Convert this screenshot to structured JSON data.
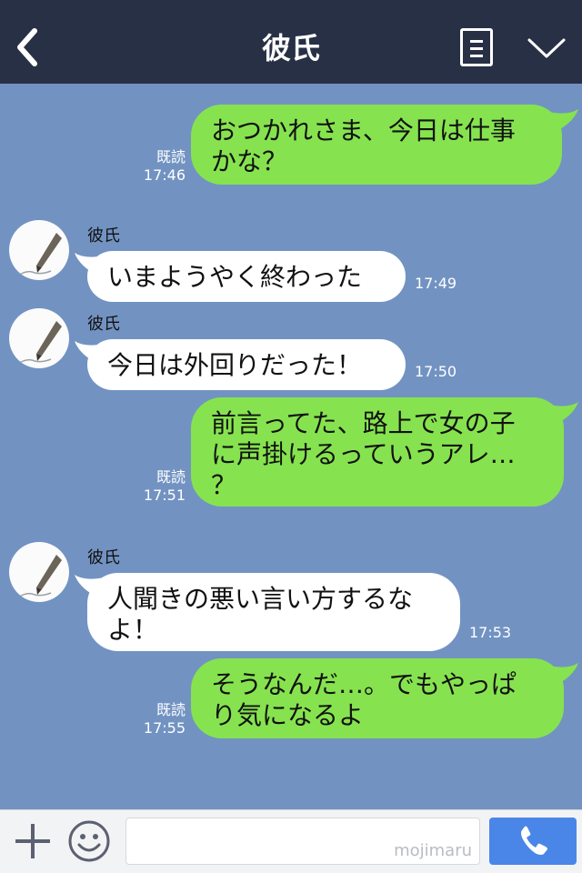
{
  "header": {
    "title": "彼氏"
  },
  "messages": [
    {
      "side": "out",
      "lines": [
        "おつかれさま、今日は仕事",
        "かな？"
      ],
      "read": "既読",
      "time": "17:46"
    },
    {
      "side": "in",
      "sender": "彼氏",
      "lines": [
        "いまようやく終わった"
      ],
      "time": "17:49"
    },
    {
      "side": "in",
      "sender": "彼氏",
      "lines": [
        "今日は外回りだった！"
      ],
      "time": "17:50"
    },
    {
      "side": "out",
      "lines": [
        "前言ってた、路上で女の子",
        "に声掛けるっていうアレ…",
        "？"
      ],
      "read": "既読",
      "time": "17:51"
    },
    {
      "side": "in",
      "sender": "彼氏",
      "lines": [
        "人聞きの悪い言い方するな",
        "よ！"
      ],
      "time": "17:53"
    },
    {
      "side": "out",
      "lines": [
        "そうなんだ…。でもやっぱ",
        "り気になるよ"
      ],
      "read": "既読",
      "time": "17:55"
    }
  ],
  "footer": {
    "watermark": "mojimaru"
  },
  "colors": {
    "header": "#283046",
    "background": "#7293c2",
    "bubble_out": "#86e34f",
    "bubble_in": "#ffffff",
    "send_button": "#4a86e8"
  },
  "icons": {
    "back": "back-chevron-icon",
    "menu": "menu-list-icon",
    "dropdown": "chevron-down-icon",
    "plus": "plus-icon",
    "emoji": "smiley-icon",
    "call": "phone-icon"
  }
}
